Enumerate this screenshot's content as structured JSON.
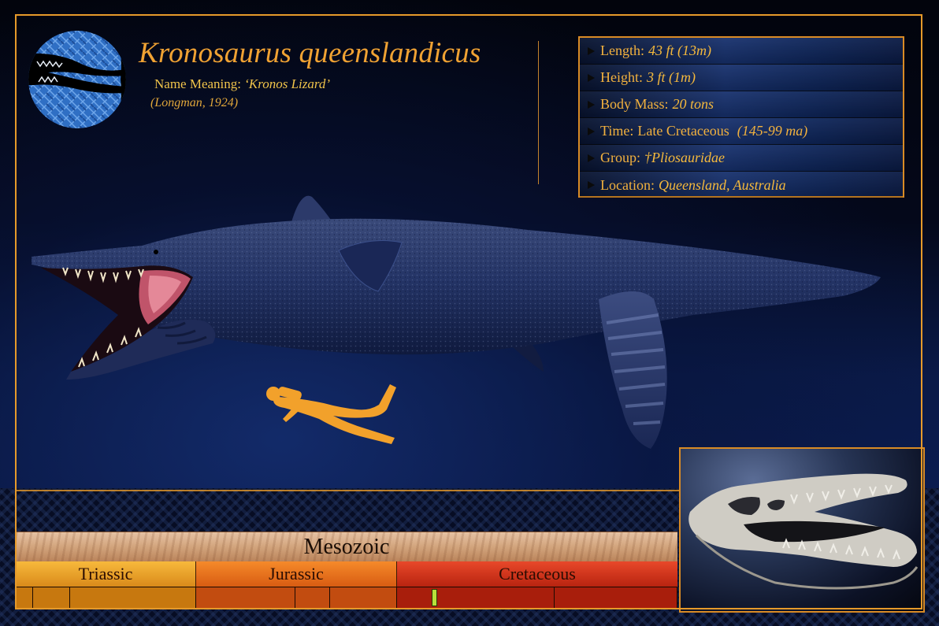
{
  "header": {
    "species": "Kronosaurus queenslandicus",
    "meaning_label": "Name Meaning:",
    "meaning_value": "‘Kronos Lizard’",
    "citation": "(Longman, 1924)"
  },
  "stats": [
    {
      "label": "Length:",
      "value": "43 ft (13m)",
      "extra": ""
    },
    {
      "label": "Height:",
      "value": "3 ft (1m)",
      "extra": ""
    },
    {
      "label": "Body Mass:",
      "value": "20 tons",
      "extra": ""
    },
    {
      "label": "Time:",
      "value": "Late Cretaceous",
      "extra": "(145-99 ma)"
    },
    {
      "label": "Group:",
      "value": "†Pliosauridae",
      "extra": ""
    },
    {
      "label": "Location:",
      "value": "Queensland, Australia",
      "extra": ""
    }
  ],
  "timeline": {
    "era": "Mesozoic",
    "periods": [
      "Triassic",
      "Jurassic",
      "Cretaceous"
    ]
  },
  "colors": {
    "accent": "#e69a2a",
    "stats_text": "#f2b13e",
    "marker": "#b8e03a"
  }
}
